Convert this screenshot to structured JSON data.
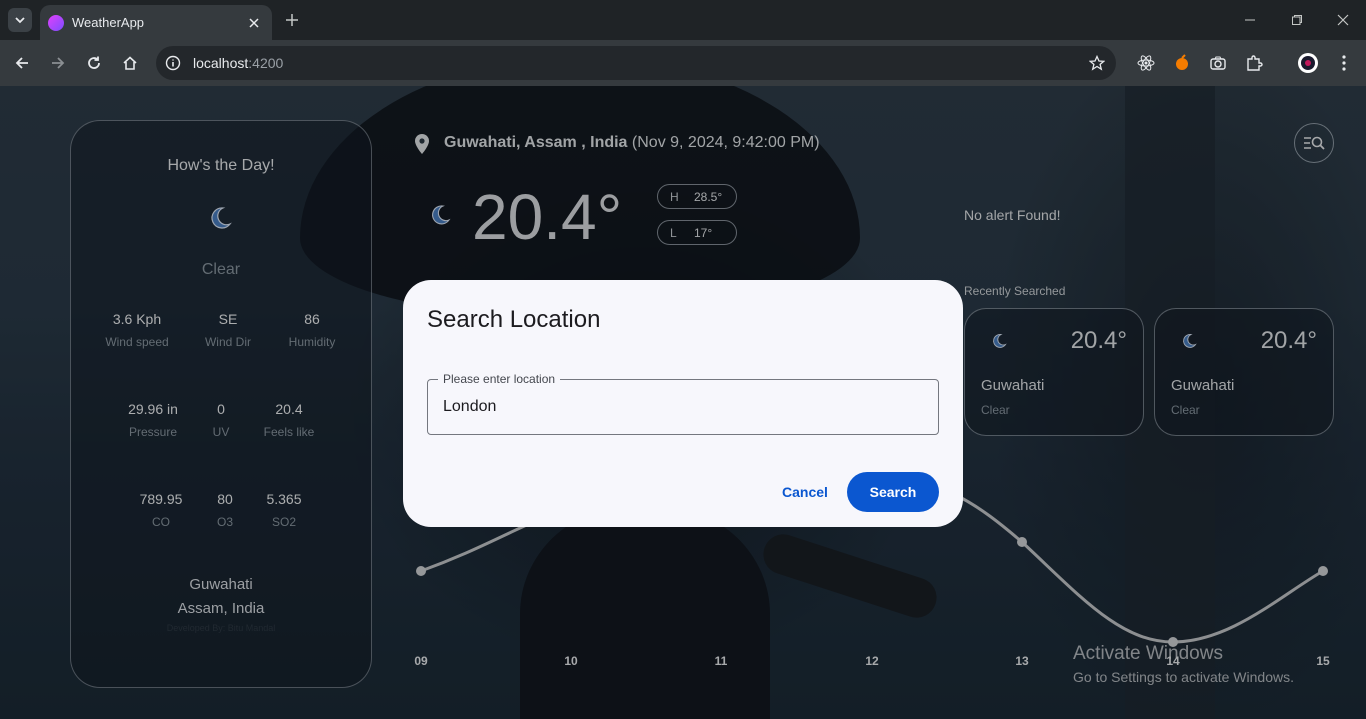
{
  "browser": {
    "tab_title": "WeatherApp",
    "url_host": "localhost",
    "url_port": ":4200"
  },
  "colors": {
    "accent": "#0b57d0",
    "dialog_bg": "#f7f7fc",
    "card_border": "#c8d2dc"
  },
  "day_card": {
    "heading": "How's the Day!",
    "condition": "Clear",
    "stats": [
      {
        "value": "3.6 Kph",
        "label": "Wind speed"
      },
      {
        "value": "SE",
        "label": "Wind Dir"
      },
      {
        "value": "86",
        "label": "Humidity"
      },
      {
        "value": "29.96 in",
        "label": "Pressure"
      },
      {
        "value": "0",
        "label": "UV"
      },
      {
        "value": "20.4",
        "label": "Feels like"
      },
      {
        "value": "789.95",
        "label": "CO"
      },
      {
        "value": "80",
        "label": "O3"
      },
      {
        "value": "5.365",
        "label": "SO2"
      }
    ],
    "city": "Guwahati",
    "region": "Assam, India",
    "developer": "Developed By: Bitu Mandal"
  },
  "current": {
    "location": "Guwahati, Assam , India",
    "datetime": "(Nov 9, 2024, 9:42:00 PM)",
    "temperature": "20.4°",
    "high_label": "H",
    "high": "28.5°",
    "low_label": "L",
    "low": "17°"
  },
  "alerts": {
    "text": "No alert Found!"
  },
  "recent": {
    "title": "Recently Searched",
    "items": [
      {
        "temp": "20.4°",
        "city": "Guwahati",
        "condition": "Clear"
      },
      {
        "temp": "20.4°",
        "city": "Guwahati",
        "condition": "Clear"
      }
    ]
  },
  "hourly": {
    "hours": [
      "09",
      "10",
      "11",
      "12",
      "13",
      "14",
      "15"
    ]
  },
  "windows_notice": {
    "line1": "Activate Windows",
    "line2": "Go to Settings to activate Windows."
  },
  "dialog": {
    "title": "Search Location",
    "field_label": "Please enter location",
    "field_value": "London",
    "cancel_label": "Cancel",
    "search_label": "Search"
  }
}
